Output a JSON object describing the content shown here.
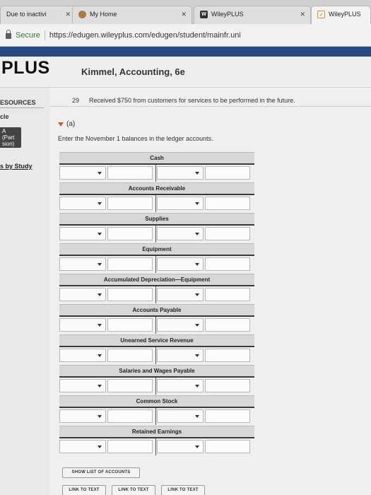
{
  "browser": {
    "tabs": [
      {
        "label": "Due to inactivi",
        "icon": "wiley-icon"
      },
      {
        "label": "My Home",
        "icon": "home-icon"
      },
      {
        "label": "WileyPLUS",
        "icon": "wiley-w-icon"
      },
      {
        "label": "WileyPLUS",
        "icon": "wiley-check-icon"
      }
    ],
    "secure_label": "Secure",
    "url": "https://edugen.wileyplus.com/edugen/student/mainfr.uni"
  },
  "header": {
    "logo": "PLUS",
    "book_title": "Kimmel, Accounting, 6e"
  },
  "sidebar": {
    "heading": "ESOURCES",
    "item": "cle",
    "badge": "A (Part sion)",
    "link": "s by Study"
  },
  "question": {
    "number": "29",
    "text": "Received $750 from customers for services to be performed in the future.",
    "part_label": "(a)",
    "instruction": "Enter the November 1 balances in the ledger accounts."
  },
  "ledgers": [
    {
      "title": "Cash"
    },
    {
      "title": "Accounts Receivable"
    },
    {
      "title": "Supplies"
    },
    {
      "title": "Equipment"
    },
    {
      "title": "Accumulated Depreciation—Equipment"
    },
    {
      "title": "Accounts Payable"
    },
    {
      "title": "Unearned Service Revenue"
    },
    {
      "title": "Salaries and Wages Payable"
    },
    {
      "title": "Common Stock"
    },
    {
      "title": "Retained Earnings"
    }
  ],
  "buttons": {
    "show_list": "SHOW LIST OF ACCOUNTS",
    "link_to_text": [
      "LINK TO TEXT",
      "LINK TO TEXT",
      "LINK TO TEXT"
    ]
  },
  "colors": {
    "brand_strip": "#2a4a86",
    "expand_caret": "#d2572b"
  }
}
